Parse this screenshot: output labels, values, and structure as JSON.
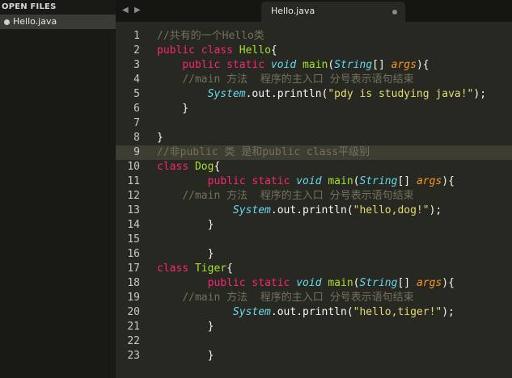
{
  "sidebar": {
    "title": "OPEN FILES",
    "files": [
      {
        "label": "Hello.java"
      }
    ]
  },
  "tabs": {
    "nav_prev": "◀",
    "nav_next": "▶",
    "items": [
      {
        "label": "Hello.java"
      }
    ]
  },
  "editor": {
    "language": "java",
    "active_line": 9,
    "lines": [
      {
        "number": "1",
        "tokens": [
          {
            "t": "cmt",
            "v": "//共有的一个Hello类"
          }
        ]
      },
      {
        "number": "2",
        "tokens": [
          {
            "t": "kw",
            "v": "public"
          },
          {
            "t": "plain",
            "v": " "
          },
          {
            "t": "kw",
            "v": "class"
          },
          {
            "t": "plain",
            "v": " "
          },
          {
            "t": "cls",
            "v": "Hello"
          },
          {
            "t": "plain",
            "v": "{"
          }
        ]
      },
      {
        "number": "3",
        "tokens": [
          {
            "t": "plain",
            "v": "    "
          },
          {
            "t": "kw",
            "v": "public"
          },
          {
            "t": "plain",
            "v": " "
          },
          {
            "t": "kw",
            "v": "static"
          },
          {
            "t": "plain",
            "v": " "
          },
          {
            "t": "typ",
            "v": "void"
          },
          {
            "t": "plain",
            "v": " "
          },
          {
            "t": "fn",
            "v": "main"
          },
          {
            "t": "plain",
            "v": "("
          },
          {
            "t": "typ",
            "v": "String"
          },
          {
            "t": "plain",
            "v": "[] "
          },
          {
            "t": "arg",
            "v": "args"
          },
          {
            "t": "plain",
            "v": "){"
          }
        ]
      },
      {
        "number": "4",
        "tokens": [
          {
            "t": "plain",
            "v": "    "
          },
          {
            "t": "cmt",
            "v": "//main 方法  程序的主入口 分号表示语句结束"
          }
        ]
      },
      {
        "number": "5",
        "tokens": [
          {
            "t": "plain",
            "v": "        "
          },
          {
            "t": "typ",
            "v": "System"
          },
          {
            "t": "plain",
            "v": "."
          },
          {
            "t": "plain",
            "v": "out"
          },
          {
            "t": "plain",
            "v": ".println("
          },
          {
            "t": "str",
            "v": "\"pdy is studying java!\""
          },
          {
            "t": "plain",
            "v": ");"
          }
        ]
      },
      {
        "number": "6",
        "tokens": [
          {
            "t": "plain",
            "v": "    }"
          }
        ]
      },
      {
        "number": "7",
        "tokens": []
      },
      {
        "number": "8",
        "tokens": [
          {
            "t": "plain",
            "v": "}"
          }
        ]
      },
      {
        "number": "9",
        "tokens": [
          {
            "t": "cmt",
            "v": "//非public 类 是和public class平级别"
          }
        ]
      },
      {
        "number": "10",
        "tokens": [
          {
            "t": "kw",
            "v": "class"
          },
          {
            "t": "plain",
            "v": " "
          },
          {
            "t": "cls",
            "v": "Dog"
          },
          {
            "t": "plain",
            "v": "{"
          }
        ]
      },
      {
        "number": "11",
        "tokens": [
          {
            "t": "plain",
            "v": "        "
          },
          {
            "t": "kw",
            "v": "public"
          },
          {
            "t": "plain",
            "v": " "
          },
          {
            "t": "kw",
            "v": "static"
          },
          {
            "t": "plain",
            "v": " "
          },
          {
            "t": "typ",
            "v": "void"
          },
          {
            "t": "plain",
            "v": " "
          },
          {
            "t": "fn",
            "v": "main"
          },
          {
            "t": "plain",
            "v": "("
          },
          {
            "t": "typ",
            "v": "String"
          },
          {
            "t": "plain",
            "v": "[] "
          },
          {
            "t": "arg",
            "v": "args"
          },
          {
            "t": "plain",
            "v": "){"
          }
        ]
      },
      {
        "number": "12",
        "tokens": [
          {
            "t": "plain",
            "v": "    "
          },
          {
            "t": "cmt",
            "v": "//main 方法  程序的主入口 分号表示语句结束"
          }
        ]
      },
      {
        "number": "13",
        "tokens": [
          {
            "t": "plain",
            "v": "            "
          },
          {
            "t": "typ",
            "v": "System"
          },
          {
            "t": "plain",
            "v": "."
          },
          {
            "t": "plain",
            "v": "out"
          },
          {
            "t": "plain",
            "v": ".println("
          },
          {
            "t": "str",
            "v": "\"hello,dog!\""
          },
          {
            "t": "plain",
            "v": ");"
          }
        ]
      },
      {
        "number": "14",
        "tokens": [
          {
            "t": "plain",
            "v": "        }"
          }
        ]
      },
      {
        "number": "15",
        "tokens": []
      },
      {
        "number": "16",
        "tokens": [
          {
            "t": "plain",
            "v": "        }"
          }
        ]
      },
      {
        "number": "17",
        "tokens": [
          {
            "t": "kw",
            "v": "class"
          },
          {
            "t": "plain",
            "v": " "
          },
          {
            "t": "cls",
            "v": "Tiger"
          },
          {
            "t": "plain",
            "v": "{"
          }
        ]
      },
      {
        "number": "18",
        "tokens": [
          {
            "t": "plain",
            "v": "        "
          },
          {
            "t": "kw",
            "v": "public"
          },
          {
            "t": "plain",
            "v": " "
          },
          {
            "t": "kw",
            "v": "static"
          },
          {
            "t": "plain",
            "v": " "
          },
          {
            "t": "typ",
            "v": "void"
          },
          {
            "t": "plain",
            "v": " "
          },
          {
            "t": "fn",
            "v": "main"
          },
          {
            "t": "plain",
            "v": "("
          },
          {
            "t": "typ",
            "v": "String"
          },
          {
            "t": "plain",
            "v": "[] "
          },
          {
            "t": "arg",
            "v": "args"
          },
          {
            "t": "plain",
            "v": "){"
          }
        ]
      },
      {
        "number": "19",
        "tokens": [
          {
            "t": "plain",
            "v": "    "
          },
          {
            "t": "cmt",
            "v": "//main 方法  程序的主入口 分号表示语句结束"
          }
        ]
      },
      {
        "number": "20",
        "tokens": [
          {
            "t": "plain",
            "v": "            "
          },
          {
            "t": "typ",
            "v": "System"
          },
          {
            "t": "plain",
            "v": "."
          },
          {
            "t": "plain",
            "v": "out"
          },
          {
            "t": "plain",
            "v": ".println("
          },
          {
            "t": "str",
            "v": "\"hello,tiger!\""
          },
          {
            "t": "plain",
            "v": ");"
          }
        ]
      },
      {
        "number": "21",
        "tokens": [
          {
            "t": "plain",
            "v": "        }"
          }
        ]
      },
      {
        "number": "22",
        "tokens": []
      },
      {
        "number": "23",
        "tokens": [
          {
            "t": "plain",
            "v": "        }"
          }
        ]
      }
    ]
  },
  "colors": {
    "background": "#272822",
    "sidebar": "#191a16",
    "keyword": "#f92672",
    "class_name": "#a6e22e",
    "type": "#66d9ef",
    "argument": "#fd971f",
    "string": "#e6db74",
    "comment": "#75715e"
  }
}
